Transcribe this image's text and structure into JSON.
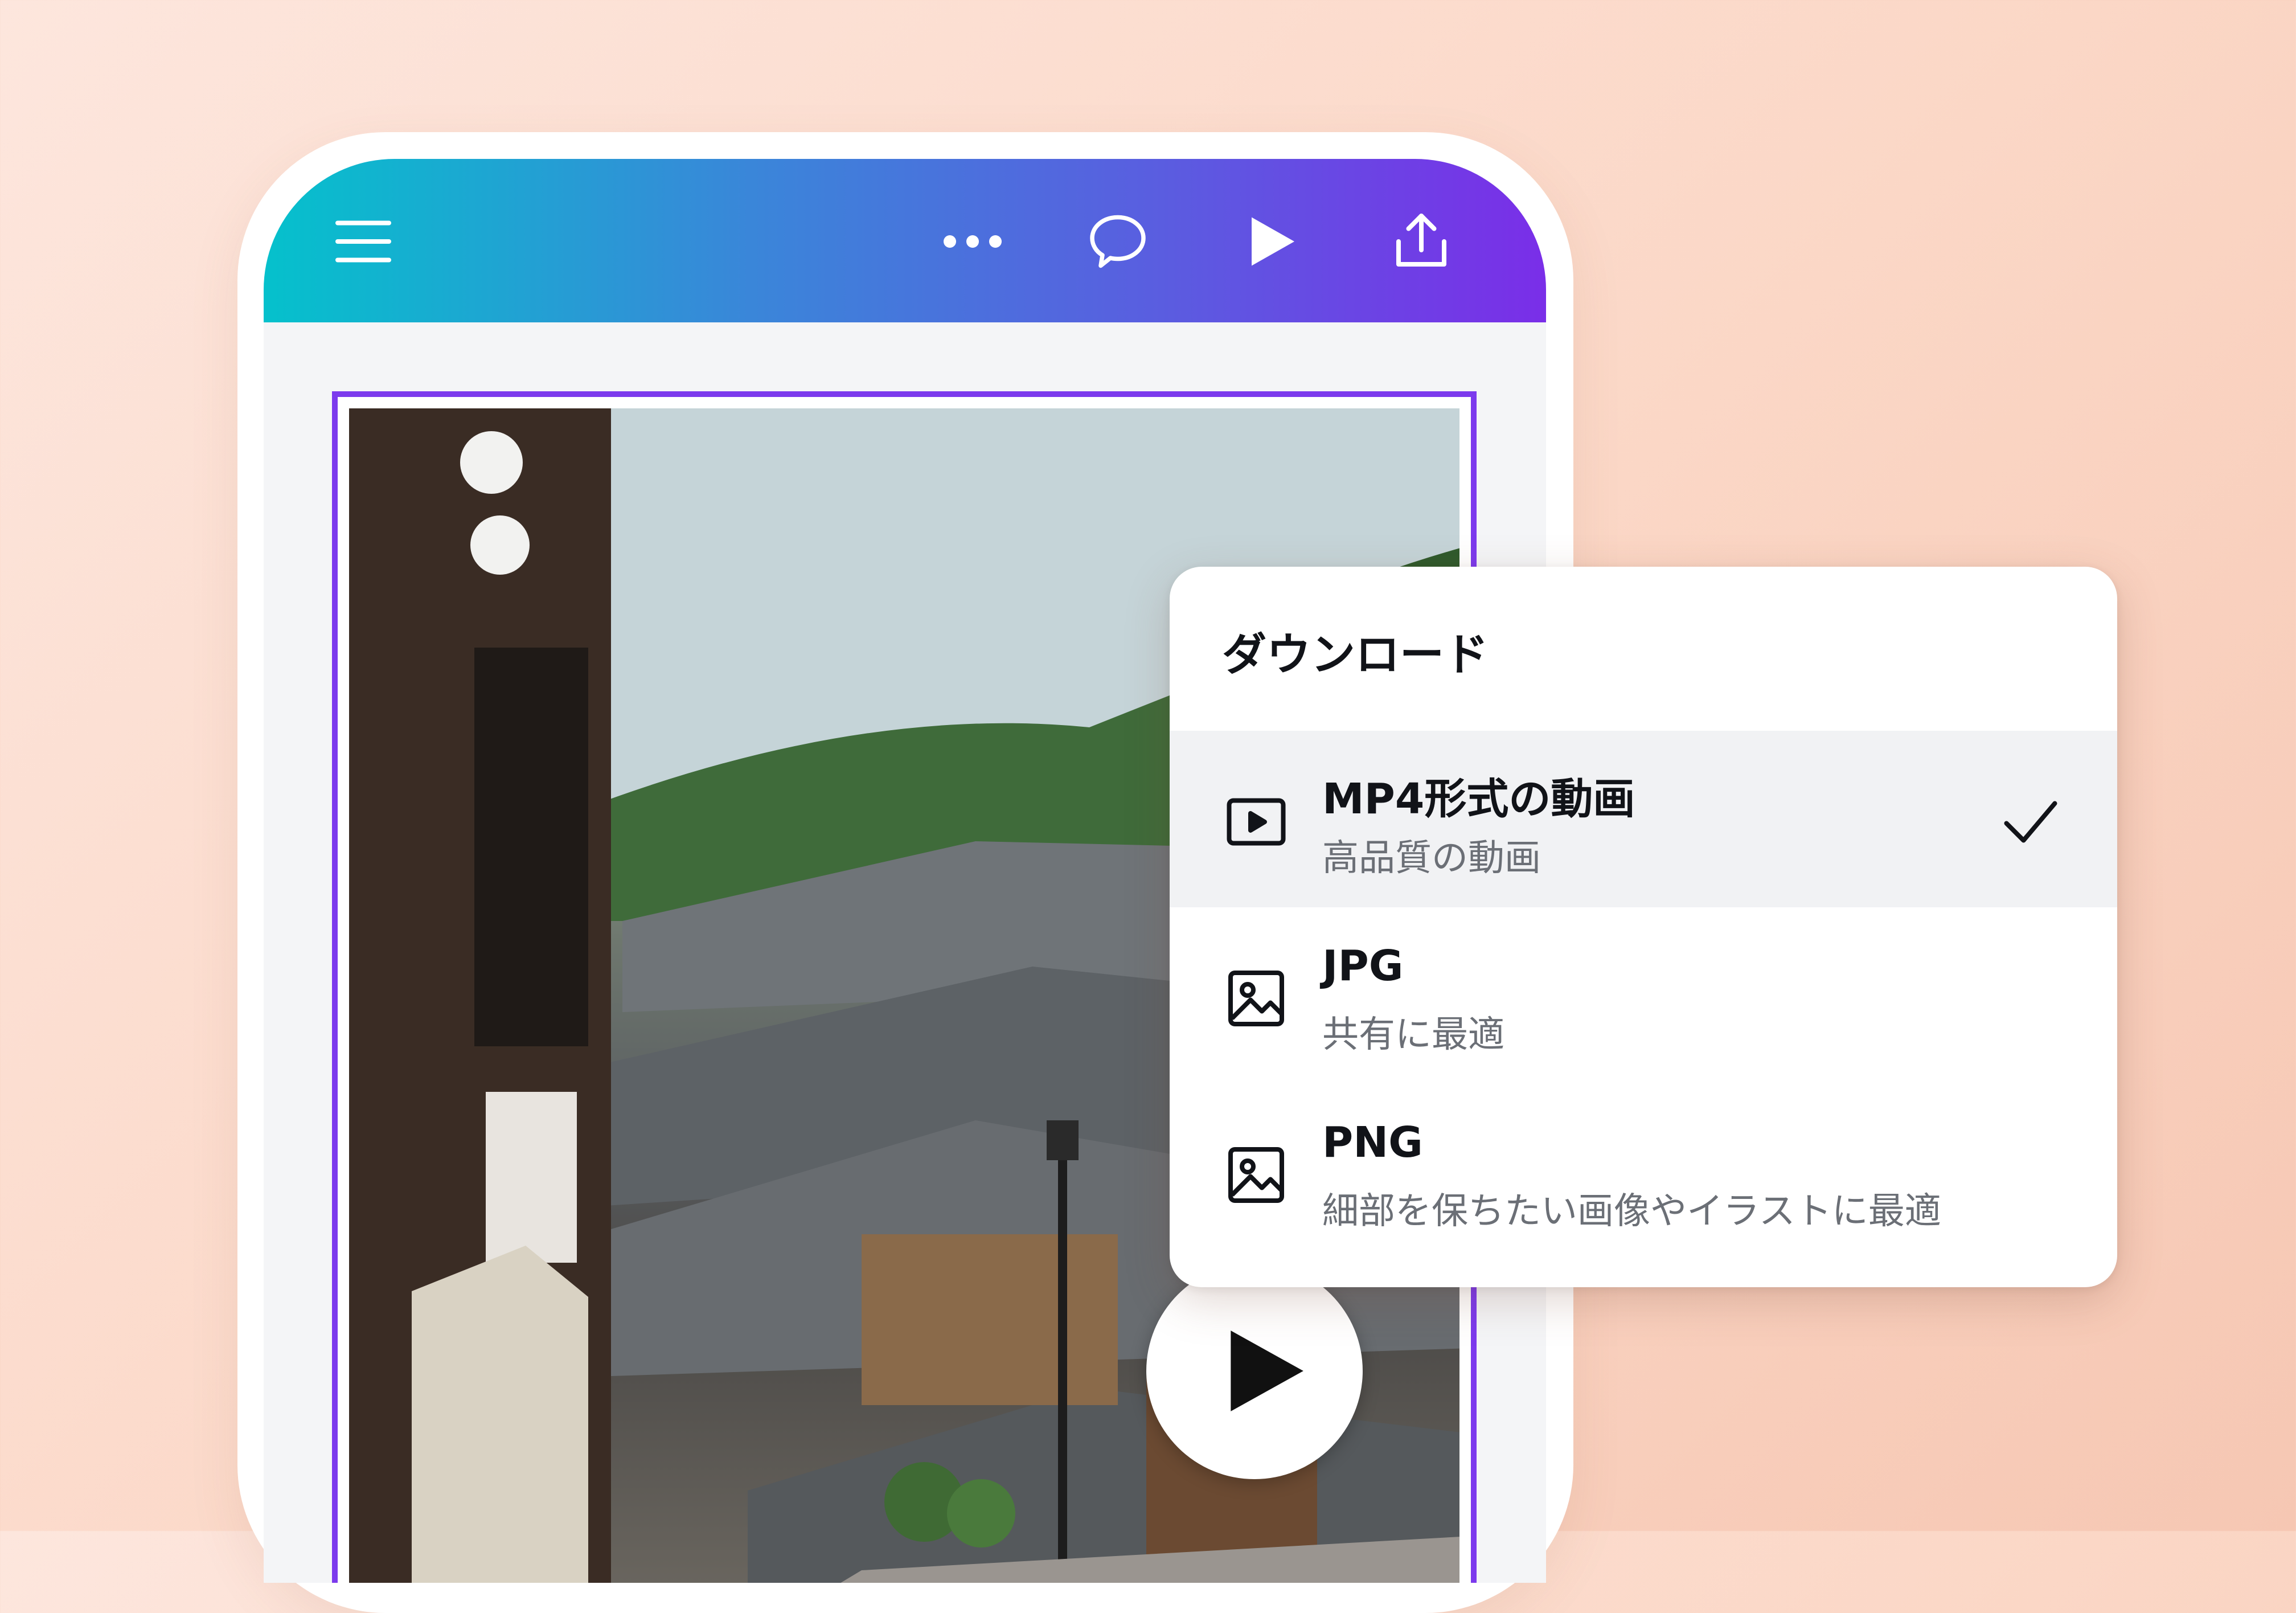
{
  "toolbar": {
    "icons": [
      "menu-icon",
      "more-icon",
      "comment-icon",
      "play-icon",
      "share-icon"
    ]
  },
  "canvas": {
    "media": "photo-kyoto-street",
    "overlay_icon": "play-icon"
  },
  "download_panel": {
    "title": "ダウンロード",
    "options": [
      {
        "label": "MP4形式の動画",
        "sub": "高品質の動画",
        "icon": "video-icon",
        "selected": true
      },
      {
        "label": "JPG",
        "sub": "共有に最適",
        "icon": "image-icon",
        "selected": false
      },
      {
        "label": "PNG",
        "sub": "細部を保ちたい画像やイラストに最適",
        "icon": "image-icon",
        "selected": false
      }
    ]
  },
  "colors": {
    "topbar_start": "#05c1cc",
    "topbar_end": "#7a2ee8",
    "selection_border": "#7c3aed",
    "selected_row": "#f1f2f4"
  }
}
